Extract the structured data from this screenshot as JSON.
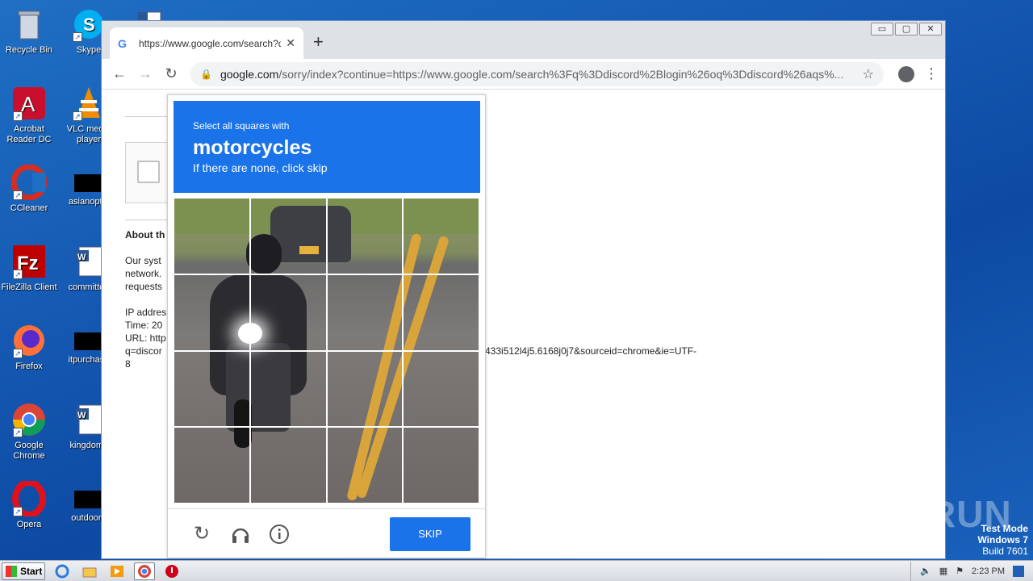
{
  "desktop": {
    "icons": [
      {
        "label": "Recycle Bin"
      },
      {
        "label": "Skype"
      },
      {
        "label": "Acrobat Reader DC"
      },
      {
        "label": "VLC media player"
      },
      {
        "label": "CCleaner"
      },
      {
        "label": "asianoptio"
      },
      {
        "label": "FileZilla Client"
      },
      {
        "label": "committee"
      },
      {
        "label": "Firefox"
      },
      {
        "label": "itpurchase"
      },
      {
        "label": "Google Chrome"
      },
      {
        "label": "kingdomfi"
      },
      {
        "label": "Opera"
      },
      {
        "label": "outdoorg"
      }
    ]
  },
  "browser": {
    "tab_title": "https://www.google.com/search?q=",
    "new_tab": "+",
    "url_host": "google.com",
    "url_rest": "/sorry/index?continue=https://www.google.com/search%3Fq%3Ddiscord%2Blogin%26oq%3Ddiscord%26aqs%...",
    "window_controls": [
      "▭",
      "▢",
      "✕"
    ]
  },
  "page": {
    "about_heading": "About th",
    "para1": [
      "Our syst",
      "network.",
      "requests"
    ],
    "ip_label": "IP addres",
    "time_label": "Time: 20",
    "url_label": "URL: http",
    "url_line": "q=discor",
    "url_continued": "433i512l4j5.6168j0j7&sourceid=chrome&ie=UTF-",
    "url_end": "8"
  },
  "captcha": {
    "instruction_small": "Select all squares with",
    "instruction_target": "motorcycles",
    "instruction_hint": "If there are none, click skip",
    "skip_label": "SKIP",
    "grid_rows": 4,
    "grid_cols": 4
  },
  "taskbar": {
    "start_label": "Start",
    "clock": "2:23 PM"
  },
  "watermark": {
    "mode": "Test Mode",
    "os": "Windows 7",
    "build": "Build 7601",
    "brand": "ANY RUN"
  }
}
